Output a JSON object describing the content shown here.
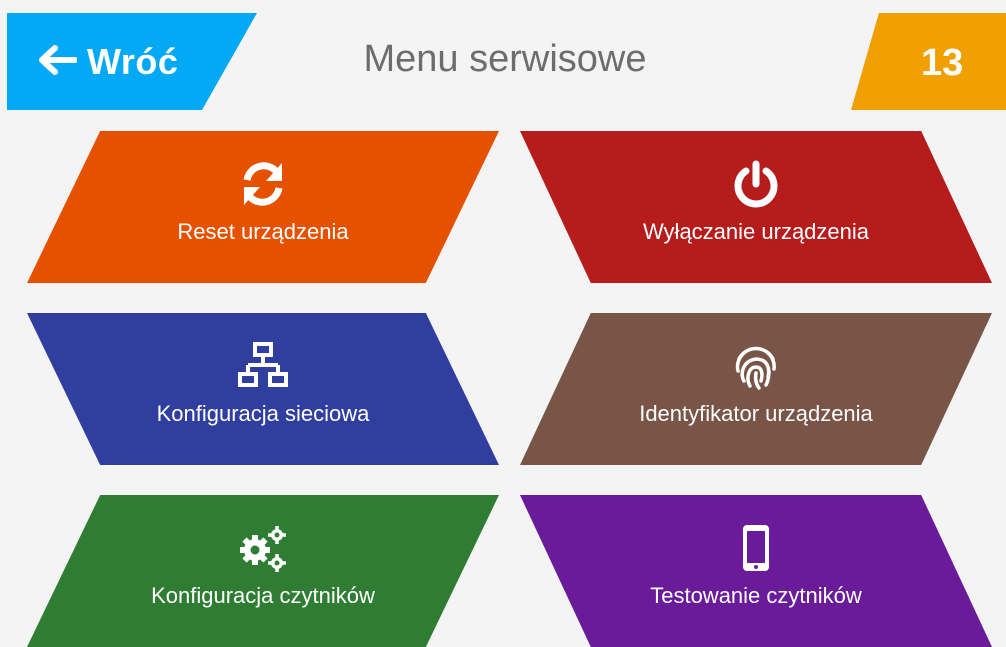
{
  "header": {
    "back_label": "Wróć",
    "title": "Menu serwisowe",
    "counter": "13"
  },
  "tiles": [
    {
      "label": "Reset urządzenia",
      "icon": "refresh-icon",
      "color": "#e65100"
    },
    {
      "label": "Wyłączanie urządzenia",
      "icon": "power-icon",
      "color": "#b71c1c"
    },
    {
      "label": "Konfiguracja sieciowa",
      "icon": "network-icon",
      "color": "#303f9f"
    },
    {
      "label": "Identyfikator urządzenia",
      "icon": "fingerprint-icon",
      "color": "#795548"
    },
    {
      "label": "Konfiguracja czytników",
      "icon": "gears-icon",
      "color": "#2e7d32"
    },
    {
      "label": "Testowanie czytników",
      "icon": "mobile-phone-icon",
      "color": "#6a1b9a"
    }
  ],
  "colors": {
    "back": "#03a9f4",
    "counter": "#f0a000",
    "background": "#f4f4f4"
  }
}
